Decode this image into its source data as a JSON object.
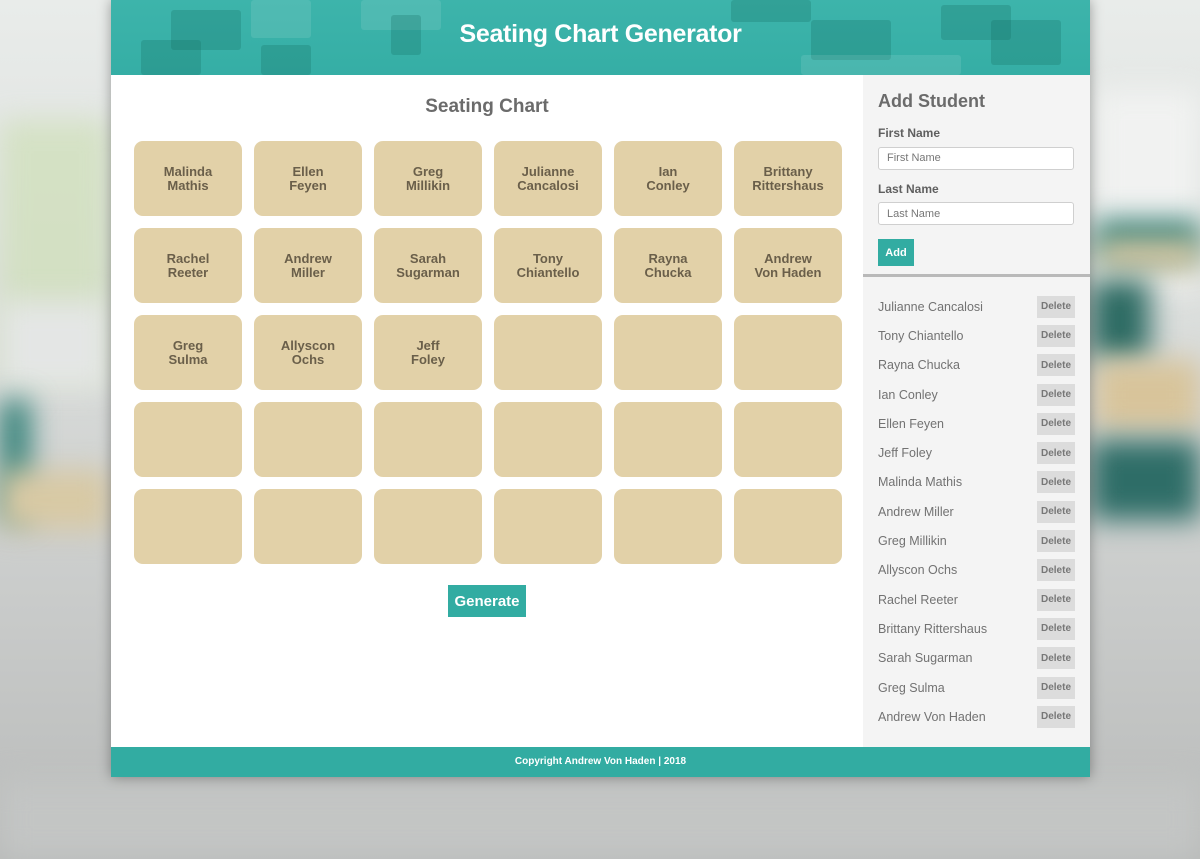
{
  "header": {
    "title": "Seating Chart Generator"
  },
  "main": {
    "title": "Seating Chart",
    "seats": [
      {
        "first": "Malinda",
        "last": "Mathis"
      },
      {
        "first": "Ellen",
        "last": "Feyen"
      },
      {
        "first": "Greg",
        "last": "Millikin"
      },
      {
        "first": "Julianne",
        "last": "Cancalosi"
      },
      {
        "first": "Ian",
        "last": "Conley"
      },
      {
        "first": "Brittany",
        "last": "Rittershaus"
      },
      {
        "first": "Rachel",
        "last": "Reeter"
      },
      {
        "first": "Andrew",
        "last": "Miller"
      },
      {
        "first": "Sarah",
        "last": "Sugarman"
      },
      {
        "first": "Tony",
        "last": "Chiantello"
      },
      {
        "first": "Rayna",
        "last": "Chucka"
      },
      {
        "first": "Andrew",
        "last": "Von Haden"
      },
      {
        "first": "Greg",
        "last": "Sulma"
      },
      {
        "first": "Allyscon",
        "last": "Ochs"
      },
      {
        "first": "Jeff",
        "last": "Foley"
      },
      {
        "first": "",
        "last": ""
      },
      {
        "first": "",
        "last": ""
      },
      {
        "first": "",
        "last": ""
      },
      {
        "first": "",
        "last": ""
      },
      {
        "first": "",
        "last": ""
      },
      {
        "first": "",
        "last": ""
      },
      {
        "first": "",
        "last": ""
      },
      {
        "first": "",
        "last": ""
      },
      {
        "first": "",
        "last": ""
      },
      {
        "first": "",
        "last": ""
      },
      {
        "first": "",
        "last": ""
      },
      {
        "first": "",
        "last": ""
      },
      {
        "first": "",
        "last": ""
      },
      {
        "first": "",
        "last": ""
      },
      {
        "first": "",
        "last": ""
      }
    ],
    "generate_label": "Generate"
  },
  "sidebar": {
    "title": "Add Student",
    "first_name_label": "First Name",
    "first_name_placeholder": "First Name",
    "first_name_value": "",
    "last_name_label": "Last Name",
    "last_name_placeholder": "Last Name",
    "last_name_value": "",
    "add_label": "Add",
    "delete_label": "Delete",
    "students": [
      "Julianne Cancalosi",
      "Tony Chiantello",
      "Rayna Chucka",
      "Ian Conley",
      "Ellen Feyen",
      "Jeff Foley",
      "Malinda Mathis",
      "Andrew Miller",
      "Greg Millikin",
      "Allyscon Ochs",
      "Rachel Reeter",
      "Brittany Rittershaus",
      "Sarah Sugarman",
      "Greg Sulma",
      "Andrew Von Haden"
    ]
  },
  "footer": {
    "text": "Copyright Andrew Von Haden | 2018"
  },
  "colors": {
    "accent": "#32aca2",
    "seat": "#e2d1a8",
    "seat_text": "#6a5f4a",
    "sidebar_bg": "#f4f4f4",
    "delete_bg": "#dcdcdc"
  }
}
